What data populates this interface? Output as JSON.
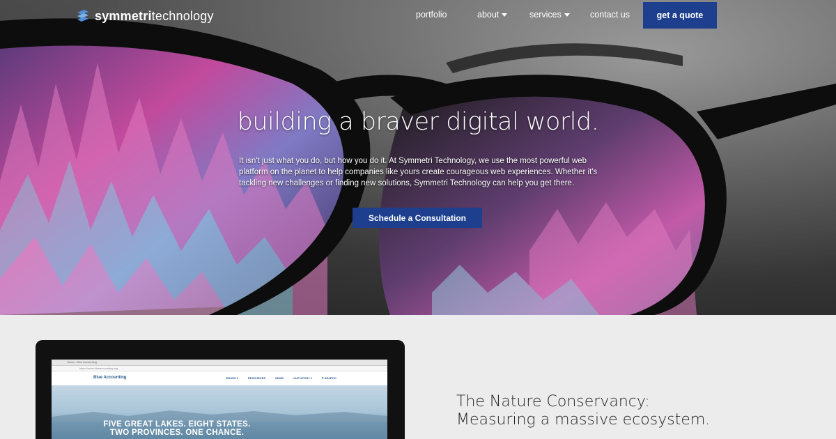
{
  "brand": {
    "name_bold": "symmetri",
    "name_rest": "technology"
  },
  "nav": {
    "portfolio": "portfolio",
    "about": "about",
    "services": "services",
    "contact": "contact us",
    "quote": "get a quote"
  },
  "hero": {
    "headline": "building a braver digital world.",
    "intro": "It isn't just what you do, but how you do it. At Symmetri Technology, we use the most powerful web platform on the planet to help companies like yours create courageous web experiences. Whether it's tackling new challenges or finding new solutions, Symmetri Technology can help you get there.",
    "cta": "Schedule a Consultation"
  },
  "case_study": {
    "title_line1": "The Nature Conservancy:",
    "title_line2": "Measuring a massive ecosystem."
  },
  "mockup": {
    "tab": "Home - Blue Accounting",
    "url": "https://www.blueaccounting.org",
    "site_logo": "Blue Accounting",
    "links": [
      "ISSUES ▾",
      "RESOURCES",
      "NEWS",
      "OUR STORY ▾",
      "⚲ SEARCH"
    ],
    "hero_line1": "FIVE GREAT LAKES. EIGHT STATES.",
    "hero_line2": "TWO PROVINCES. ONE CHANCE."
  },
  "colors": {
    "accent": "#1d3f8e",
    "lens_pink": "#d24ea3",
    "lens_cyan": "#7fd6e6"
  }
}
